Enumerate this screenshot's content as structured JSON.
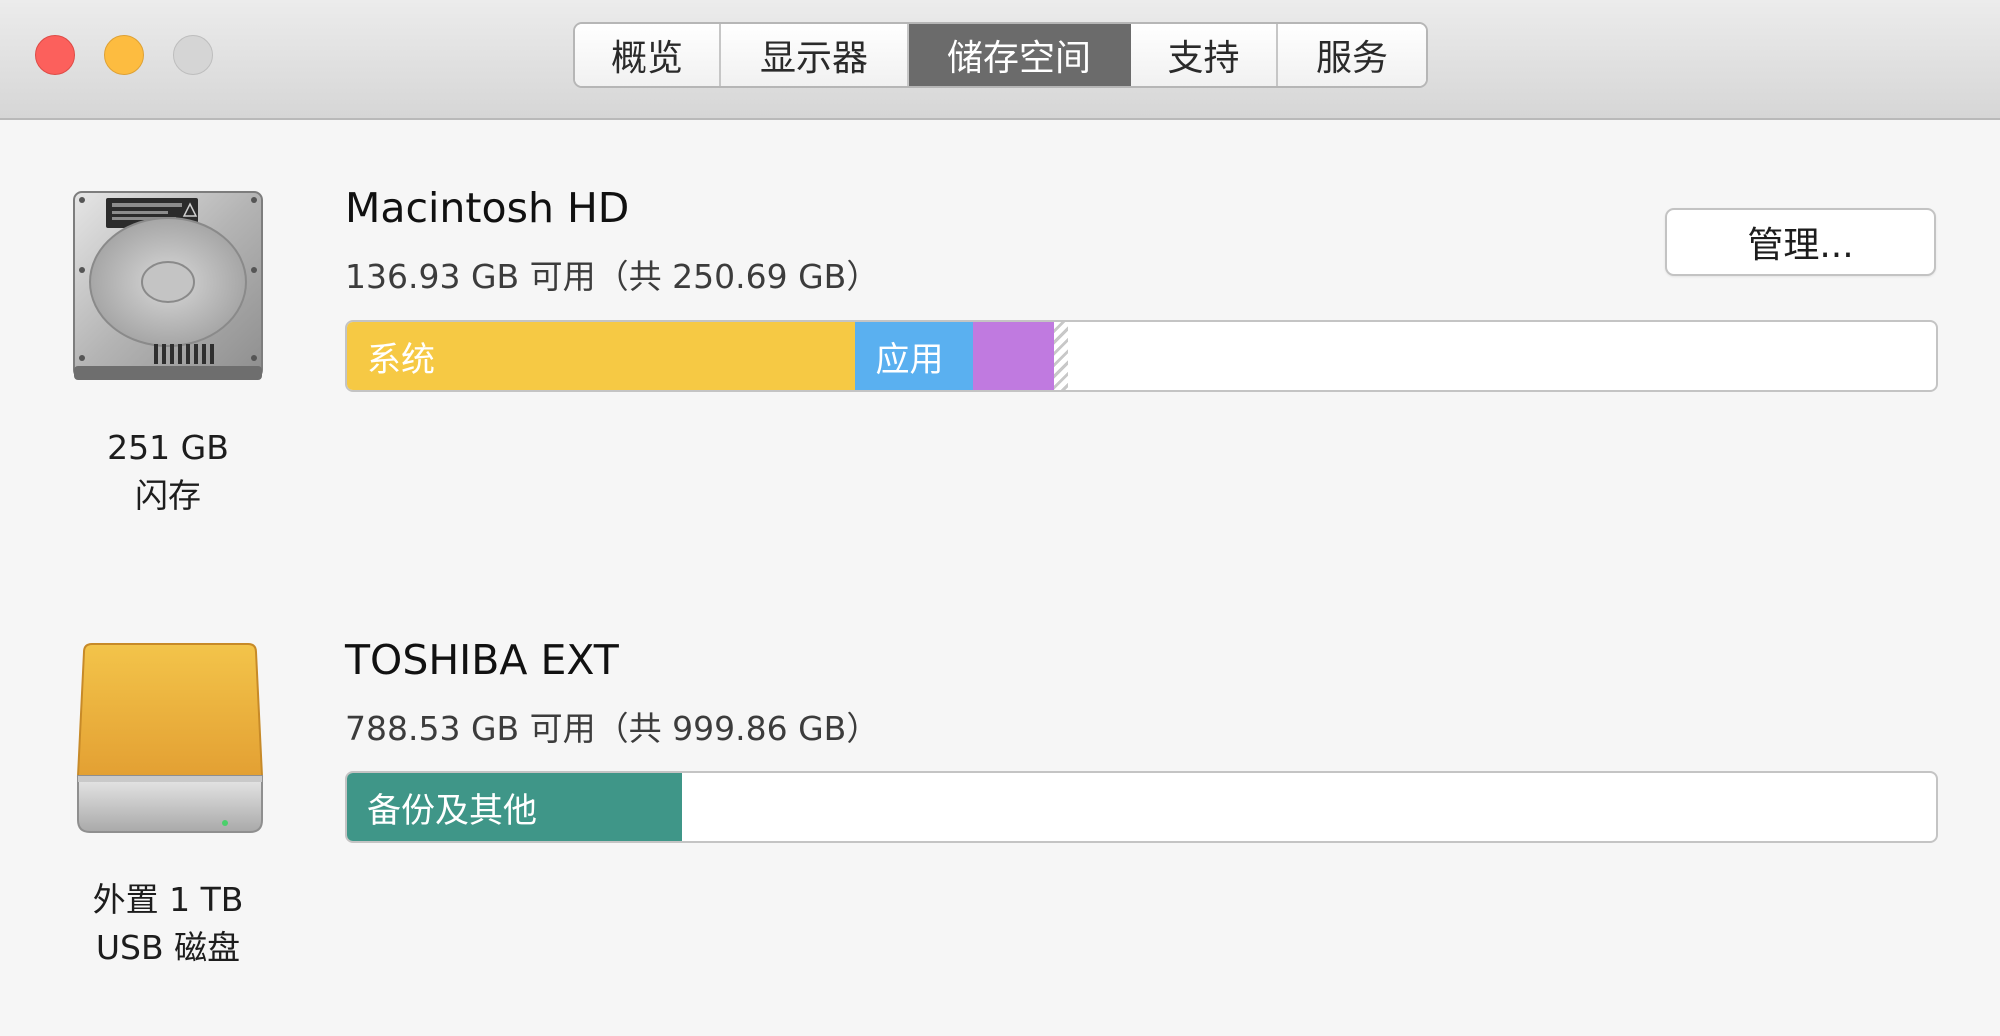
{
  "window": {
    "tabs": [
      {
        "label": "概览"
      },
      {
        "label": "显示器"
      },
      {
        "label": "储存空间"
      },
      {
        "label": "支持"
      },
      {
        "label": "服务"
      }
    ],
    "active_tab": "储存空间"
  },
  "drives": [
    {
      "name": "Macintosh HD",
      "availability": "136.93 GB 可用（共 250.69 GB）",
      "caption_line1": "251 GB",
      "caption_line2": "闪存",
      "icon": "internal-hard-drive-icon",
      "manage_label": "管理...",
      "segments": [
        {
          "label": "系统",
          "fraction": 0.32,
          "color": "#f6c944"
        },
        {
          "label": "应用",
          "fraction": 0.074,
          "color": "#5ab0f0"
        },
        {
          "label": "",
          "fraction": 0.051,
          "color": "#c07ae0"
        },
        {
          "label": "",
          "fraction": 0.009,
          "color": "hatch"
        }
      ]
    },
    {
      "name": "TOSHIBA EXT",
      "availability": "788.53 GB 可用（共 999.86 GB）",
      "caption_line1": "外置 1 TB",
      "caption_line2": "USB 磁盘",
      "icon": "external-usb-drive-icon",
      "segments": [
        {
          "label": "备份及其他",
          "fraction": 0.211,
          "color": "#3f9688"
        }
      ]
    }
  ]
}
